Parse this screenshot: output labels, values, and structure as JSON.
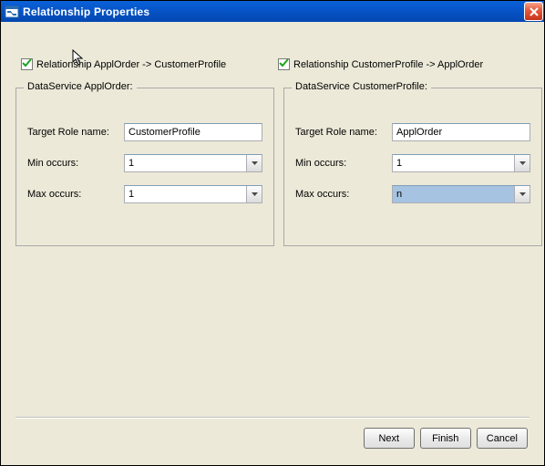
{
  "window": {
    "title": "Relationship Properties"
  },
  "checkboxes": {
    "left": {
      "label": "Relationship ApplOrder -> CustomerProfile",
      "checked": true
    },
    "right": {
      "label": "Relationship CustomerProfile -> ApplOrder",
      "checked": true
    }
  },
  "panels": {
    "left": {
      "legend": "DataService ApplOrder:",
      "targetRole": {
        "label": "Target Role name:",
        "value": "CustomerProfile"
      },
      "minOccurs": {
        "label": "Min occurs:",
        "value": "1"
      },
      "maxOccurs": {
        "label": "Max occurs:",
        "value": "1"
      }
    },
    "right": {
      "legend": "DataService CustomerProfile:",
      "targetRole": {
        "label": "Target Role name:",
        "value": "ApplOrder"
      },
      "minOccurs": {
        "label": "Min occurs:",
        "value": "1"
      },
      "maxOccurs": {
        "label": "Max occurs:",
        "value": "n",
        "highlighted": true
      }
    }
  },
  "buttons": {
    "next": "Next",
    "finish": "Finish",
    "cancel": "Cancel"
  }
}
